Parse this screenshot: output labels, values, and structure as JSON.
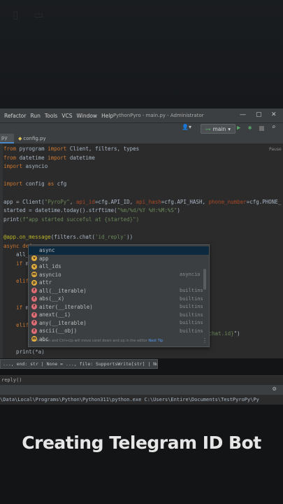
{
  "menu": {
    "items": [
      "Refactor",
      "Run",
      "Tools",
      "VCS",
      "Window",
      "Help"
    ],
    "window_title": "PythonPyro - main.py - Administrator"
  },
  "toolbar": {
    "branch": "main"
  },
  "tabs": [
    {
      "label": "py",
      "active": true
    },
    {
      "label": "config.py",
      "active": false
    }
  ],
  "editor": {
    "paused_label": "Pause",
    "lines": [
      [
        {
          "t": "from ",
          "c": "kw"
        },
        {
          "t": "pyrogram ",
          "c": "plain"
        },
        {
          "t": "import ",
          "c": "kw"
        },
        {
          "t": "Client, filters, types",
          "c": "plain"
        }
      ],
      [
        {
          "t": "from ",
          "c": "kw"
        },
        {
          "t": "datetime ",
          "c": "plain"
        },
        {
          "t": "import ",
          "c": "kw"
        },
        {
          "t": "datetime",
          "c": "plain"
        }
      ],
      [
        {
          "t": "import ",
          "c": "kw"
        },
        {
          "t": "asyncio",
          "c": "plain"
        }
      ],
      [],
      [
        {
          "t": "import ",
          "c": "kw"
        },
        {
          "t": "config ",
          "c": "plain"
        },
        {
          "t": "as ",
          "c": "kw"
        },
        {
          "t": "cfg",
          "c": "plain"
        }
      ],
      [],
      [
        {
          "t": "app = Client(",
          "c": "plain"
        },
        {
          "t": "\"PyroPy\"",
          "c": "str"
        },
        {
          "t": ", ",
          "c": "plain"
        },
        {
          "t": "api_id",
          "c": "param"
        },
        {
          "t": "=cfg.API_ID, ",
          "c": "plain"
        },
        {
          "t": "api_hash",
          "c": "param"
        },
        {
          "t": "=cfg.API_HASH, ",
          "c": "plain"
        },
        {
          "t": "phone_number",
          "c": "param"
        },
        {
          "t": "=cfg.PHONE_",
          "c": "plain"
        }
      ],
      [
        {
          "t": "started = datetime.today().strftime(",
          "c": "plain"
        },
        {
          "t": "\"%m/%d/%Y %H:%M:%S\"",
          "c": "str"
        },
        {
          "t": ")",
          "c": "plain"
        }
      ],
      [
        {
          "t": "print",
          "c": "plain"
        },
        {
          "t": "(f\"app started succeful at {started}\")",
          "c": "str"
        }
      ],
      [],
      [
        {
          "t": "@app.on_message",
          "c": "dec"
        },
        {
          "t": "(filters.chat(",
          "c": "plain"
        },
        {
          "t": "'id_reply'",
          "c": "str"
        },
        {
          "t": "))",
          "c": "plain"
        }
      ],
      [
        {
          "t": "async def ",
          "c": "kw"
        },
        {
          "t": "                        ",
          "c": "plain"
        }
      ],
      [
        {
          "t": "    all_",
          "c": "plain"
        }
      ],
      [
        {
          "t": "    if ",
          "c": "kw"
        },
        {
          "t": "m",
          "c": "plain"
        }
      ],
      [],
      [
        {
          "t": "    elif",
          "c": "kw"
        }
      ],
      [
        {
          "t": "                                                     ",
          "c": "plain"
        },
        {
          "t": "n')",
          "c": "str"
        }
      ],
      [],
      [
        {
          "t": "    if ",
          "c": "kw"
        },
        {
          "t": "m",
          "c": "plain"
        }
      ],
      [
        {
          "t": "                                                     ",
          "c": "plain"
        },
        {
          "t": "rom.id}",
          "c": "str"
        },
        {
          "t": ")",
          "c": "plain"
        }
      ],
      [
        {
          "t": "    elif",
          "c": "kw"
        }
      ],
      [
        {
          "t": "                                                     ",
          "c": "plain"
        },
        {
          "t": "orward_from_chat.id}",
          "c": "str"
        },
        {
          "t": "\")",
          "c": "plain"
        }
      ],
      [],
      [
        {
          "t": "    print(",
          "c": "plain"
        },
        {
          "t": "*a",
          "c": "plain"
        },
        {
          "t": ")",
          "c": "plain"
        }
      ]
    ]
  },
  "completion": {
    "items": [
      {
        "label": "async",
        "type": "",
        "icon": "",
        "color": ""
      },
      {
        "label": "app",
        "type": "",
        "icon": "v",
        "color": "#e0a93b"
      },
      {
        "label": "all_ids",
        "type": "",
        "icon": "v",
        "color": "#e0a93b"
      },
      {
        "label": "asyncio",
        "type": "asyncio",
        "icon": "m",
        "color": "#e0a93b"
      },
      {
        "label": "attr",
        "type": "",
        "icon": "p",
        "color": "#e0a93b"
      },
      {
        "label": "all(__iterable)",
        "type": "builtins",
        "icon": "f",
        "color": "#e06c75"
      },
      {
        "label": "abs(__x)",
        "type": "builtins",
        "icon": "f",
        "color": "#e06c75"
      },
      {
        "label": "aiter(__iterable)",
        "type": "builtins",
        "icon": "f",
        "color": "#e06c75"
      },
      {
        "label": "anext(__i)",
        "type": "builtins",
        "icon": "f",
        "color": "#e06c75"
      },
      {
        "label": "any(__iterable)",
        "type": "builtins",
        "icon": "f",
        "color": "#e06c75"
      },
      {
        "label": "ascii(__obj)",
        "type": "builtins",
        "icon": "f",
        "color": "#e06c75"
      },
      {
        "label": "abc",
        "type": "",
        "icon": "m",
        "color": "#e0a93b"
      }
    ],
    "hint": "Ctrl+Down and Ctrl+Up will move caret down and up in the editor",
    "tip": "Next Tip"
  },
  "param_info": "..., end: str | None = ..., file: SupportsWrite[str] | None = ..., flush: bool = ...",
  "bottom_tab": "reply()",
  "console_line": "\\Data\\Local\\Programs\\Python\\Python311\\python.exe C:\\Users\\Entire\\Documents\\TestPyroPy\\Py",
  "caption": "Creating Telegram ID Bot"
}
